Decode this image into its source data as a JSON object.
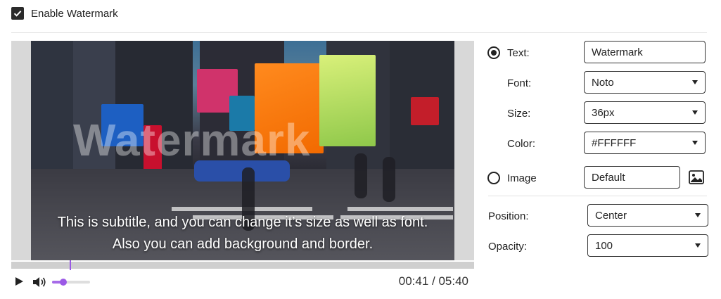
{
  "enable": {
    "label": "Enable Watermark",
    "checked": true
  },
  "player": {
    "watermark_text": "Watermark",
    "subtitle_line1": "This is subtitle, and you can change it’s size as well as font.",
    "subtitle_line2": "Also you can add background and border.",
    "progress_fraction": 0.1265,
    "volume_fraction": 0.3,
    "timecode": "00:41 / 05:40"
  },
  "settings": {
    "text_option": {
      "label": "Text:",
      "selected": true,
      "value": "Watermark"
    },
    "font": {
      "label": "Font:",
      "value": "Noto"
    },
    "size": {
      "label": "Size:",
      "value": "36px"
    },
    "color": {
      "label": "Color:",
      "value": "#FFFFFF"
    },
    "image_option": {
      "label": "Image",
      "selected": false,
      "value": "Default"
    },
    "position": {
      "label": "Position:",
      "value": "Center"
    },
    "opacity": {
      "label": "Opacity:",
      "value": "100"
    }
  },
  "colors": {
    "accent": "#9b59e6",
    "checkbox": "#2b2b2b"
  },
  "icons": [
    "checkmark-icon",
    "play-icon",
    "volume-icon",
    "chevron-down-icon",
    "image-icon"
  ]
}
